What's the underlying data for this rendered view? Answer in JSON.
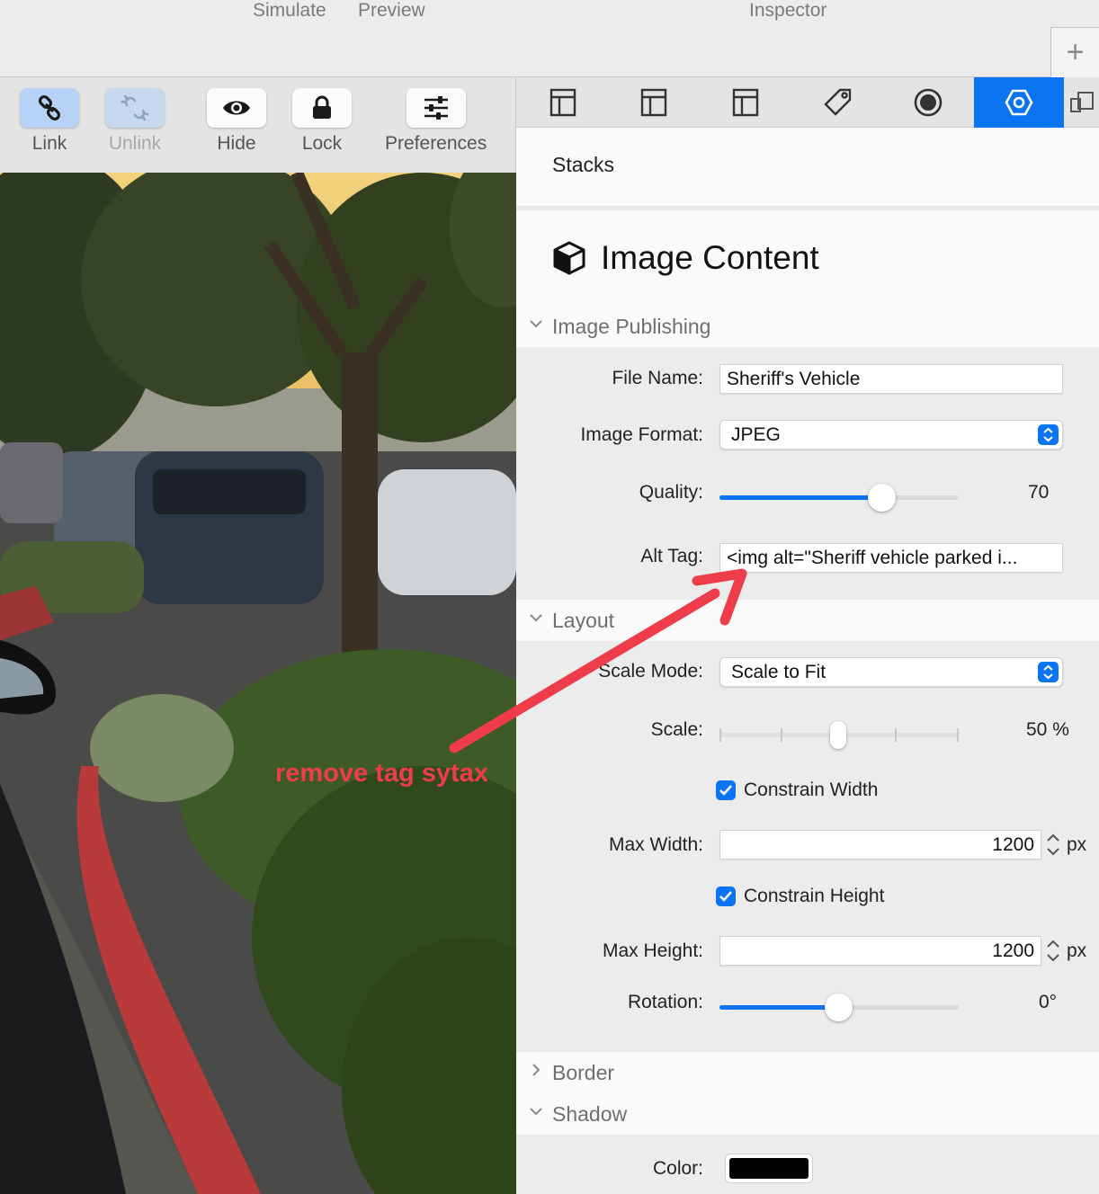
{
  "topbar": {
    "simulate": "Simulate",
    "preview": "Preview",
    "inspector": "Inspector",
    "add": "+"
  },
  "toolbar": {
    "link": "Link",
    "unlink": "Unlink",
    "hide": "Hide",
    "lock": "Lock",
    "preferences": "Preferences"
  },
  "annotation": "remove tag sytax",
  "inspector": {
    "breadcrumb": "Stacks",
    "title": "Image Content",
    "sections": {
      "publishing": "Image Publishing",
      "layout": "Layout",
      "border": "Border",
      "shadow": "Shadow"
    },
    "publishing": {
      "file_name_label": "File Name:",
      "file_name_value": "Sheriff's Vehicle",
      "format_label": "Image Format:",
      "format_value": "JPEG",
      "quality_label": "Quality:",
      "quality_value": "70",
      "quality_fraction": 0.7,
      "alt_label": "Alt Tag:",
      "alt_value": "<img alt=\"Sheriff vehicle parked i..."
    },
    "layout": {
      "scale_mode_label": "Scale Mode:",
      "scale_mode_value": "Scale to Fit",
      "scale_label": "Scale:",
      "scale_value": "50 %",
      "constrain_width": "Constrain Width",
      "max_width_label": "Max Width:",
      "max_width_value": "1200",
      "constrain_height": "Constrain Height",
      "max_height_label": "Max Height:",
      "max_height_value": "1200",
      "unit": "px",
      "rotation_label": "Rotation:",
      "rotation_value": "0°"
    },
    "shadow": {
      "color_label": "Color:",
      "color_value": "#000000"
    }
  },
  "colors": {
    "accent": "#0a74f2",
    "annotation": "#ee3c4a"
  }
}
